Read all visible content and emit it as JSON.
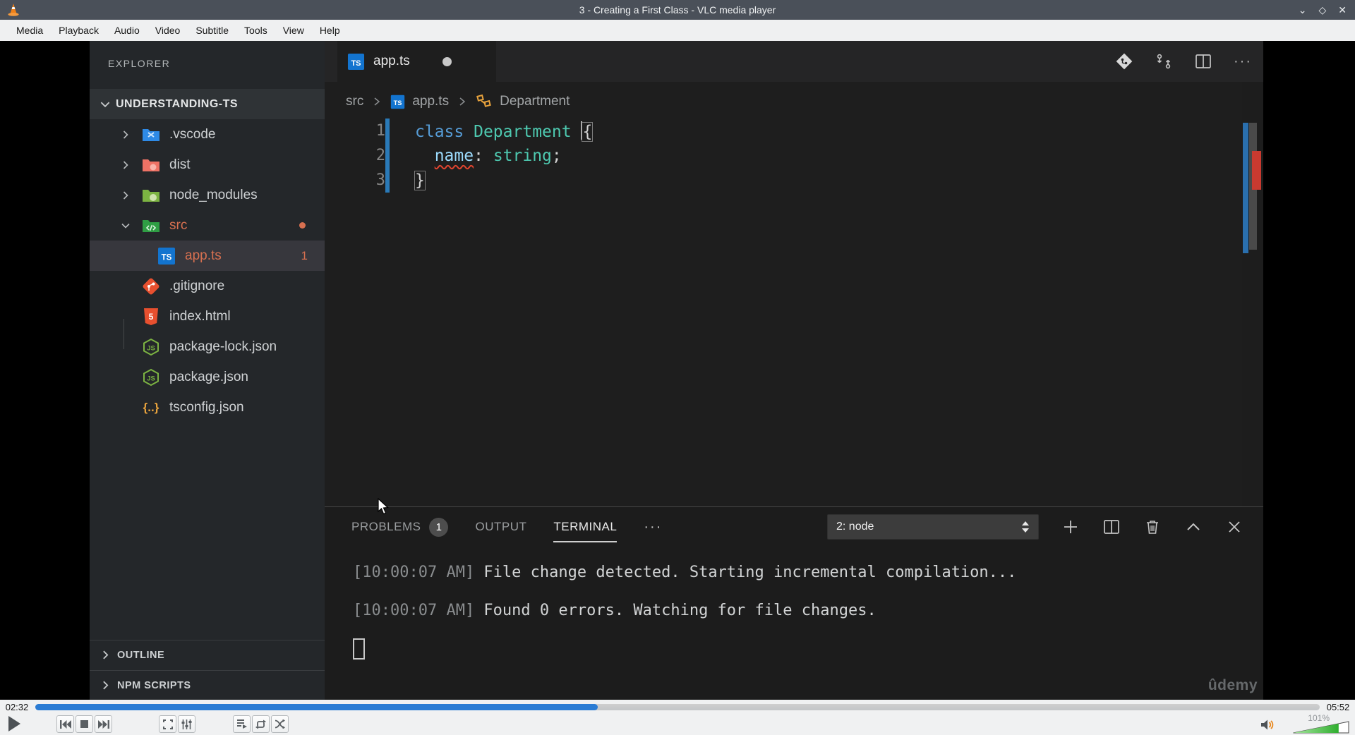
{
  "window": {
    "title": "3 - Creating a First Class - VLC media player"
  },
  "icons": {
    "minimize_glyph": "⌄",
    "maximize_glyph": "◇",
    "close_glyph": "✕",
    "more_glyph": "···",
    "braces_glyph": "{..}"
  },
  "menubar": {
    "items": [
      "Media",
      "Playback",
      "Audio",
      "Video",
      "Subtitle",
      "Tools",
      "View",
      "Help"
    ]
  },
  "vscode": {
    "explorer": {
      "title": "EXPLORER",
      "root_label": "UNDERSTANDING-TS",
      "items": [
        {
          "label": ".vscode"
        },
        {
          "label": "dist"
        },
        {
          "label": "node_modules"
        },
        {
          "label": "src"
        },
        {
          "label": "app.ts",
          "badge": "1"
        },
        {
          "label": ".gitignore"
        },
        {
          "label": "index.html"
        },
        {
          "label": "package-lock.json"
        },
        {
          "label": "package.json"
        },
        {
          "label": "tsconfig.json"
        }
      ],
      "sections": [
        {
          "label": "OUTLINE"
        },
        {
          "label": "NPM SCRIPTS"
        }
      ]
    },
    "editor": {
      "tab_label": "app.ts",
      "ts_badge": "TS",
      "breadcrumb": {
        "folder": "src",
        "file": "app.ts",
        "symbol": "Department"
      },
      "code": {
        "line_numbers": [
          "1",
          "2",
          "3"
        ],
        "l1": {
          "keyword": "class",
          "type": "Department",
          "brace": "{"
        },
        "l2": {
          "indent": "  ",
          "property": "name",
          "colon": ":",
          "type": "string",
          "semicolon": ";"
        },
        "l3": {
          "brace": "}"
        }
      }
    },
    "panel": {
      "tabs": {
        "problems": "PROBLEMS",
        "problems_badge": "1",
        "output": "OUTPUT",
        "terminal": "TERMINAL"
      },
      "terminal_select": "2: node",
      "terminal_lines": [
        {
          "time": "[10:00:07 AM]",
          "message": " File change detected. Starting incremental compilation..."
        },
        {
          "time": "[10:00:07 AM]",
          "message": " Found 0 errors. Watching for file changes."
        }
      ],
      "watermark": "ûdemy"
    }
  },
  "player": {
    "elapsed": "02:32",
    "duration": "05:52",
    "progress_pct": 43.8,
    "volume_label": "101%",
    "volume_fill_pct": 82
  },
  "colors": {
    "accent_blue": "#2b7cd4",
    "modified_orange": "#d77050",
    "error_red": "#e0442f",
    "ts_blue": "#1374cf",
    "keyword_blue": "#569cd6",
    "type_teal": "#4ec9b0",
    "property_blue": "#9cdcfe"
  }
}
